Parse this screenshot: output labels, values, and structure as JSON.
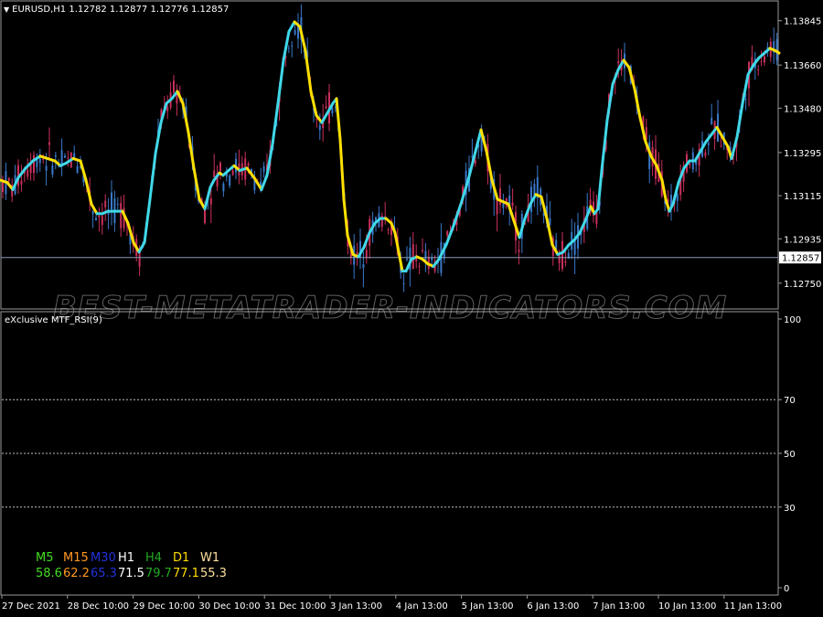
{
  "symbol_header": {
    "symbol": "EURUSD,H1",
    "open": "1.12782",
    "high": "1.12877",
    "low": "1.12776",
    "close": "1.12857"
  },
  "main_chart": {
    "price_axis": [
      "1.13845",
      "1.13660",
      "1.13480",
      "1.13295",
      "1.13115",
      "1.12935",
      "1.12750"
    ],
    "current_price": "1.12857",
    "price_range": [
      1.1265,
      1.1392
    ],
    "colors": {
      "up_line": "#40d8e8",
      "down_line": "#ffe000",
      "bull_candle": "#3a78c8",
      "bear_candle": "#c8305a",
      "price_line": "#8a9bb8"
    }
  },
  "watermark": "BEST-METATRADER-INDICATORS.COM",
  "indicator": {
    "title": "eXclusive MTF_RSI(9)",
    "levels": [
      "100",
      "70",
      "50",
      "30",
      "0"
    ],
    "mtf": {
      "timeframes": [
        {
          "tf": "M5",
          "value": "58.6",
          "color": "#44dd22"
        },
        {
          "tf": "M15",
          "value": "62.2",
          "color": "#ff9922"
        },
        {
          "tf": "M30",
          "value": "65.3",
          "color": "#2233dd"
        },
        {
          "tf": "H1",
          "value": "71.5",
          "color": "#ffffff"
        },
        {
          "tf": "H4",
          "value": "79.7",
          "color": "#22aa22"
        },
        {
          "tf": "D1",
          "value": "77.1",
          "color": "#ffdd00"
        },
        {
          "tf": "W1",
          "value": "55.3",
          "color": "#ffe0a0"
        }
      ]
    }
  },
  "time_axis": [
    "27 Dec 2021",
    "28 Dec 10:00",
    "29 Dec 10:00",
    "30 Dec 10:00",
    "31 Dec 10:00",
    "3 Jan 13:00",
    "4 Jan 13:00",
    "5 Jan 13:00",
    "6 Jan 13:00",
    "7 Jan 13:00",
    "10 Jan 13:00",
    "11 Jan 13:00"
  ],
  "chart_data": {
    "type": "line",
    "title": "EURUSD,H1",
    "series": [
      {
        "name": "EURUSD",
        "points": [
          [
            0,
            1.1318
          ],
          [
            8,
            1.1317
          ],
          [
            14,
            1.1314
          ],
          [
            20,
            1.1319
          ],
          [
            28,
            1.1323
          ],
          [
            36,
            1.1326
          ],
          [
            44,
            1.1328
          ],
          [
            52,
            1.1327
          ],
          [
            60,
            1.1326
          ],
          [
            66,
            1.1324
          ],
          [
            72,
            1.1325
          ],
          [
            80,
            1.1327
          ],
          [
            88,
            1.1326
          ],
          [
            94,
            1.1318
          ],
          [
            100,
            1.1308
          ],
          [
            106,
            1.1304
          ],
          [
            112,
            1.1304
          ],
          [
            118,
            1.1305
          ],
          [
            126,
            1.1305
          ],
          [
            134,
            1.1305
          ],
          [
            140,
            1.13
          ],
          [
            146,
            1.1292
          ],
          [
            152,
            1.1288
          ],
          [
            158,
            1.1292
          ],
          [
            164,
            1.131
          ],
          [
            170,
            1.1329
          ],
          [
            176,
            1.1342
          ],
          [
            182,
            1.135
          ],
          [
            188,
            1.1352
          ],
          [
            194,
            1.1355
          ],
          [
            200,
            1.135
          ],
          [
            206,
            1.1338
          ],
          [
            212,
            1.1323
          ],
          [
            218,
            1.131
          ],
          [
            224,
            1.1306
          ],
          [
            230,
            1.1315
          ],
          [
            234,
            1.1318
          ],
          [
            240,
            1.1321
          ],
          [
            244,
            1.132
          ],
          [
            250,
            1.1322
          ],
          [
            256,
            1.1324
          ],
          [
            262,
            1.1322
          ],
          [
            270,
            1.1323
          ],
          [
            278,
            1.1319
          ],
          [
            286,
            1.1314
          ],
          [
            292,
            1.132
          ],
          [
            298,
            1.1333
          ],
          [
            304,
            1.135
          ],
          [
            310,
            1.1368
          ],
          [
            316,
            1.138
          ],
          [
            322,
            1.1384
          ],
          [
            328,
            1.1382
          ],
          [
            334,
            1.1372
          ],
          [
            340,
            1.1355
          ],
          [
            346,
            1.1345
          ],
          [
            352,
            1.1342
          ],
          [
            358,
            1.1346
          ],
          [
            364,
            1.135
          ],
          [
            368,
            1.1352
          ],
          [
            372,
            1.1335
          ],
          [
            376,
            1.131
          ],
          [
            380,
            1.1295
          ],
          [
            386,
            1.1287
          ],
          [
            392,
            1.1286
          ],
          [
            398,
            1.129
          ],
          [
            404,
            1.1296
          ],
          [
            410,
            1.13
          ],
          [
            416,
            1.1302
          ],
          [
            422,
            1.1302
          ],
          [
            428,
            1.13
          ],
          [
            432,
            1.1296
          ],
          [
            436,
            1.1288
          ],
          [
            440,
            1.128
          ],
          [
            444,
            1.128
          ],
          [
            450,
            1.1285
          ],
          [
            456,
            1.1286
          ],
          [
            462,
            1.1285
          ],
          [
            468,
            1.1283
          ],
          [
            474,
            1.1282
          ],
          [
            480,
            1.1285
          ],
          [
            488,
            1.1291
          ],
          [
            496,
            1.1299
          ],
          [
            504,
            1.1308
          ],
          [
            512,
            1.1318
          ],
          [
            520,
            1.133
          ],
          [
            526,
            1.1339
          ],
          [
            532,
            1.133
          ],
          [
            538,
            1.1318
          ],
          [
            544,
            1.131
          ],
          [
            550,
            1.1309
          ],
          [
            556,
            1.1308
          ],
          [
            562,
            1.1301
          ],
          [
            568,
            1.1294
          ],
          [
            574,
            1.1302
          ],
          [
            580,
            1.1308
          ],
          [
            586,
            1.1312
          ],
          [
            592,
            1.1311
          ],
          [
            598,
            1.1302
          ],
          [
            604,
            1.1291
          ],
          [
            610,
            1.1287
          ],
          [
            616,
            1.1288
          ],
          [
            622,
            1.1291
          ],
          [
            628,
            1.1293
          ],
          [
            634,
            1.1296
          ],
          [
            640,
            1.1301
          ],
          [
            646,
            1.1307
          ],
          [
            650,
            1.1304
          ],
          [
            654,
            1.1306
          ],
          [
            658,
            1.1322
          ],
          [
            664,
            1.1343
          ],
          [
            670,
            1.1358
          ],
          [
            676,
            1.1364
          ],
          [
            682,
            1.1368
          ],
          [
            688,
            1.1365
          ],
          [
            694,
            1.1356
          ],
          [
            700,
            1.1344
          ],
          [
            706,
            1.1334
          ],
          [
            712,
            1.1328
          ],
          [
            718,
            1.1324
          ],
          [
            724,
            1.1318
          ],
          [
            728,
            1.131
          ],
          [
            732,
            1.1305
          ],
          [
            736,
            1.1308
          ],
          [
            742,
            1.1317
          ],
          [
            748,
            1.1323
          ],
          [
            754,
            1.1326
          ],
          [
            760,
            1.1326
          ],
          [
            766,
            1.133
          ],
          [
            772,
            1.1334
          ],
          [
            778,
            1.1337
          ],
          [
            784,
            1.134
          ],
          [
            790,
            1.1336
          ],
          [
            796,
            1.1332
          ],
          [
            800,
            1.1327
          ],
          [
            806,
            1.1336
          ],
          [
            812,
            1.135
          ],
          [
            818,
            1.1362
          ],
          [
            824,
            1.1366
          ],
          [
            830,
            1.1369
          ],
          [
            836,
            1.1371
          ],
          [
            842,
            1.1373
          ],
          [
            848,
            1.1372
          ],
          [
            852,
            1.1371
          ]
        ]
      }
    ],
    "ylim": [
      1.1265,
      1.1392
    ],
    "y_ticks": [
      1.13845,
      1.1366,
      1.1348,
      1.13295,
      1.13115,
      1.12935,
      1.1275
    ],
    "grid": false
  }
}
